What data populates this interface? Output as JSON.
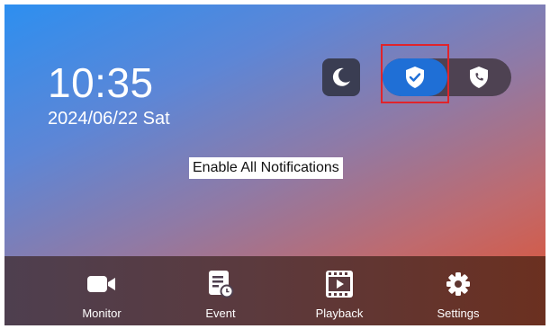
{
  "clock": {
    "time": "10:35",
    "date": "2024/06/22 Sat"
  },
  "mode_toggle": {
    "moon_icon": "moon-icon",
    "options": [
      {
        "icon": "shield-check-icon",
        "active": true
      },
      {
        "icon": "shield-phone-icon",
        "active": false
      }
    ]
  },
  "tooltip": {
    "text": "Enable All Notifications"
  },
  "nav": {
    "items": [
      {
        "label": "Monitor",
        "icon": "video-camera-icon"
      },
      {
        "label": "Event",
        "icon": "event-log-icon"
      },
      {
        "label": "Playback",
        "icon": "film-play-icon"
      },
      {
        "label": "Settings",
        "icon": "gear-icon"
      }
    ]
  },
  "colors": {
    "accent": "#1f6fd6",
    "highlight": "#e0242b"
  }
}
